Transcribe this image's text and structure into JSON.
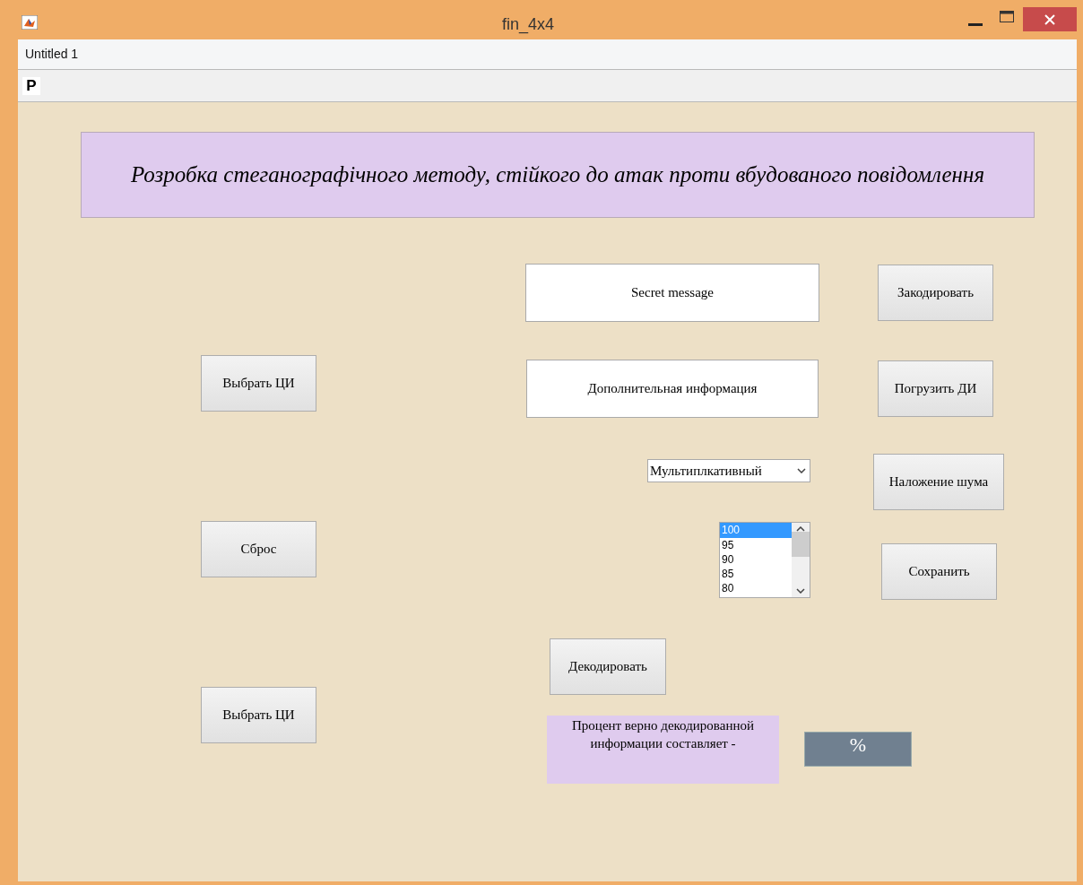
{
  "window": {
    "title": "fin_4x4"
  },
  "menu_bar": {
    "label": "Untitled 1"
  },
  "toolbar": {
    "button_label": "P"
  },
  "heading": "Розробка стеганографічного методу, стійкого до атак проти вбудованого повідомлення",
  "controls": [
    {
      "kind": "edit",
      "value": "Secret message"
    },
    {
      "kind": "button",
      "label": "Закодировать"
    },
    {
      "kind": "button",
      "label": "Выбрать ЦИ"
    },
    {
      "kind": "edit",
      "value": "Дополнительная информация"
    },
    {
      "kind": "button",
      "label": "Погрузить ДИ"
    },
    {
      "kind": "popup",
      "value": "Мультиплкативный"
    },
    {
      "kind": "button",
      "label": "Наложение шума"
    },
    {
      "kind": "button",
      "label": "Сброс"
    },
    {
      "kind": "listbox",
      "items": [
        {
          "label": "100",
          "selected": true
        },
        {
          "label": "95",
          "selected": false
        },
        {
          "label": "90",
          "selected": false
        },
        {
          "label": "85",
          "selected": false
        },
        {
          "label": "80",
          "selected": false
        }
      ]
    },
    {
      "kind": "button",
      "label": "Сохранить"
    },
    {
      "kind": "button",
      "label": "Декодировать"
    },
    {
      "kind": "button",
      "label": "Выбрать ЦИ"
    },
    {
      "kind": "text_panel",
      "text": "Процент верно декодированной информации составляет -"
    },
    {
      "kind": "result",
      "text": "%"
    }
  ]
}
